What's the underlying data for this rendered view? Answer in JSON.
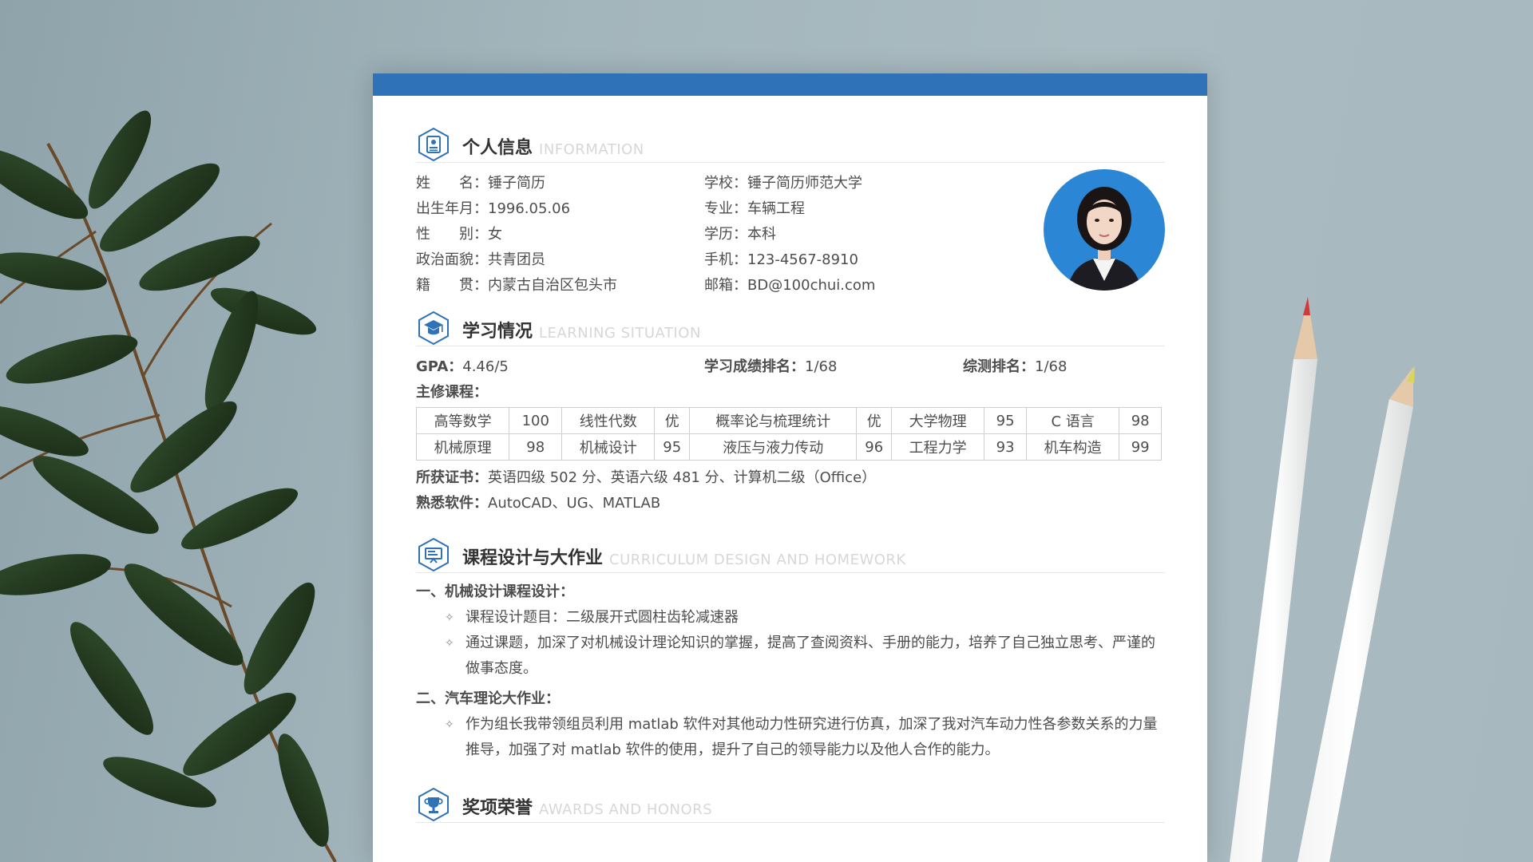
{
  "sections": {
    "info": {
      "title": "个人信息",
      "en": "INFORMATION"
    },
    "study": {
      "title": "学习情况",
      "en": "LEARNING SITUATION"
    },
    "course": {
      "title": "课程设计与大作业",
      "en": "CURRICULUM DESIGN AND HOMEWORK"
    },
    "awards": {
      "title": "奖项荣誉",
      "en": "AWARDS AND HONORS"
    }
  },
  "personal_left": [
    {
      "label": "姓　　名：",
      "value": "锤子简历"
    },
    {
      "label": "出生年月：",
      "value": "1996.05.06"
    },
    {
      "label": "性　　别：",
      "value": "女"
    },
    {
      "label": "政治面貌：",
      "value": "共青团员"
    },
    {
      "label": "籍　　贯：",
      "value": "内蒙古自治区包头市"
    }
  ],
  "personal_mid": [
    {
      "label": "学校：",
      "value": "锤子简历师范大学"
    },
    {
      "label": "专业：",
      "value": "车辆工程"
    },
    {
      "label": "学历：",
      "value": "本科"
    },
    {
      "label": "手机：",
      "value": "123-4567-8910"
    },
    {
      "label": "邮箱：",
      "value": "BD@100chui.com"
    }
  ],
  "study": {
    "gpa_label": "GPA：",
    "gpa": "4.46/5",
    "rank_label": "学习成绩排名：",
    "rank": "1/68",
    "overall_label": "综测排名：",
    "overall": "1/68",
    "courses_label": "主修课程：",
    "courses": [
      [
        "高等数学",
        "100",
        "线性代数",
        "优",
        "概率论与梳理统计",
        "优",
        "大学物理",
        "95",
        "C 语言",
        "98"
      ],
      [
        "机械原理",
        "98",
        "机械设计",
        "95",
        "液压与液力传动",
        "96",
        "工程力学",
        "93",
        "机车构造",
        "99"
      ]
    ],
    "cert_label": "所获证书：",
    "cert": "英语四级 502 分、英语六级 481 分、计算机二级（Office）",
    "software_label": "熟悉软件：",
    "software": "AutoCAD、UG、MATLAB"
  },
  "course_design": {
    "items": [
      {
        "title": "一、机械设计课程设计：",
        "bullets": [
          "课程设计题目：二级展开式圆柱齿轮减速器",
          "通过课题，加深了对机械设计理论知识的掌握，提高了查阅资料、手册的能力，培养了自己独立思考、严谨的做事态度。"
        ]
      },
      {
        "title": "二、汽车理论大作业：",
        "bullets": [
          "作为组长我带领组员利用 matlab 软件对其他动力性研究进行仿真，加深了我对汽车动力性各参数关系的力量推导，加强了对 matlab 软件的使用，提升了自己的领导能力以及他人合作的能力。"
        ]
      }
    ]
  },
  "colors": {
    "accent": "#2f72b8",
    "heading": "#333333",
    "text": "#4d4d4d",
    "en_heading": "#d7d7d7"
  },
  "icons": {
    "info": "id-card-icon",
    "study": "graduation-cap-icon",
    "course": "presentation-board-icon",
    "awards": "trophy-icon"
  }
}
